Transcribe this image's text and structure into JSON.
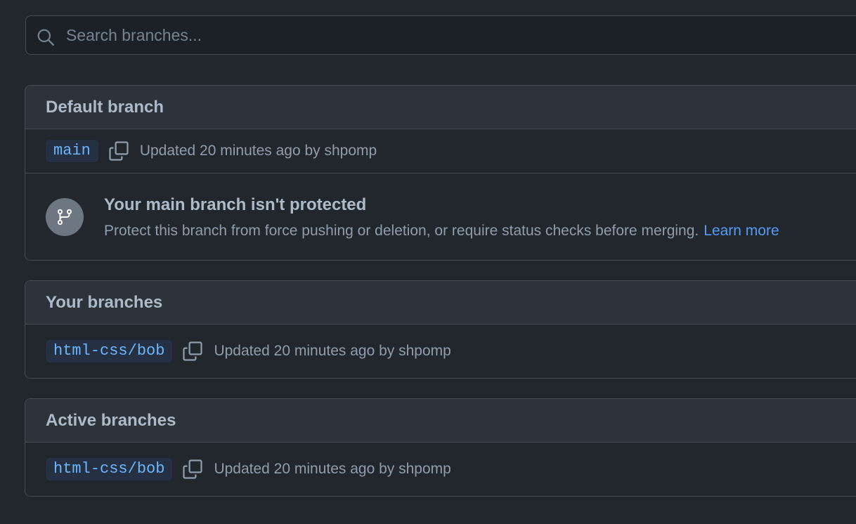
{
  "search": {
    "placeholder": "Search branches...",
    "icon": "search-icon"
  },
  "default_section": {
    "title": "Default branch",
    "branch": {
      "name": "main",
      "updated": "Updated 20 minutes ago by shpomp"
    },
    "protection": {
      "icon": "git-branch-icon",
      "title": "Your main branch isn't protected",
      "description": "Protect this branch from force pushing or deletion, or require status checks before merging.",
      "link_label": "Learn more"
    }
  },
  "your_section": {
    "title": "Your branches",
    "branches": [
      {
        "name": "html-css/bob",
        "updated": "Updated 20 minutes ago by shpomp"
      }
    ]
  },
  "active_section": {
    "title": "Active branches",
    "branches": [
      {
        "name": "html-css/bob",
        "updated": "Updated 20 minutes ago by shpomp"
      }
    ]
  },
  "colors": {
    "background": "#22272e",
    "header_background": "#2d333b",
    "border": "#444c56",
    "branch_text": "#6cb6ff",
    "branch_pill": "#253142",
    "link": "#539bf5",
    "muted_text": "#909dab"
  }
}
